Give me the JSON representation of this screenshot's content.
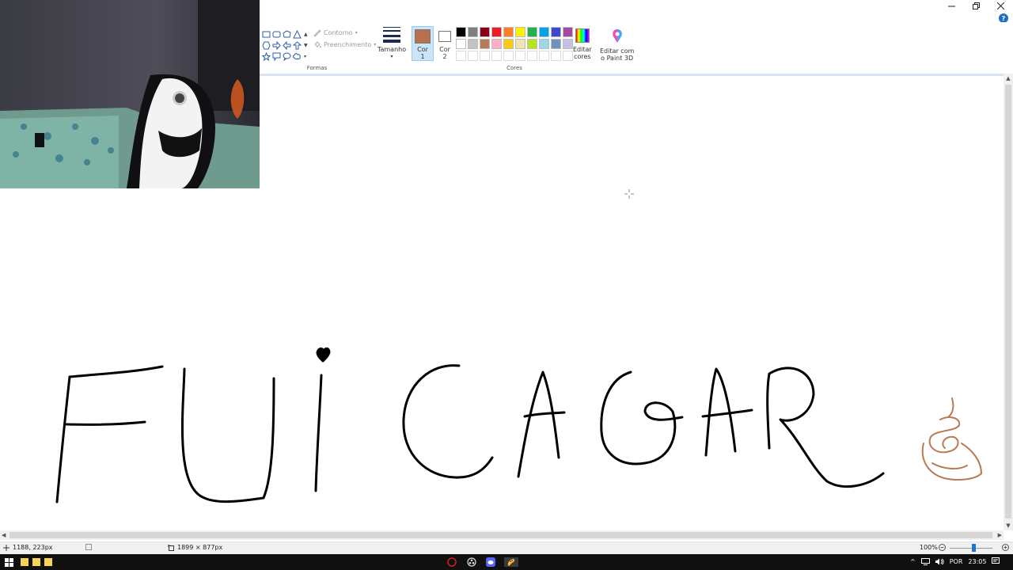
{
  "window": {
    "minimize_icon": "minimize-icon",
    "restore_icon": "restore-icon",
    "close_icon": "close-icon",
    "help_label": "?"
  },
  "ribbon": {
    "groups": {
      "shapes": "Formas",
      "colors": "Cores"
    },
    "outline_label": "Contorno",
    "fill_label": "Preenchimento",
    "size_label": "Tamanho",
    "color1_label": "Cor\n1",
    "color1_line1": "Cor",
    "color1_line2": "1",
    "color2_line1": "Cor",
    "color2_line2": "2",
    "color1_value": "#b9704f",
    "color2_value": "#ffffff",
    "edit_colors_line1": "Editar",
    "edit_colors_line2": "cores",
    "paint3d_line1": "Editar com",
    "paint3d_line2": "o Paint 3D",
    "palette_row1": [
      "#000000",
      "#7f7f7f",
      "#880015",
      "#ed1c24",
      "#ff7f27",
      "#fff200",
      "#22b14c",
      "#00a2e8",
      "#3f48cc",
      "#a349a4"
    ],
    "palette_row2": [
      "#ffffff",
      "#c3c3c3",
      "#b97a57",
      "#ffaec9",
      "#ffc90e",
      "#efe4b0",
      "#b5e61d",
      "#99d9ea",
      "#7092be",
      "#c8bfe7"
    ],
    "palette_row3": [
      "#ffffff",
      "#ffffff",
      "#ffffff",
      "#ffffff",
      "#ffffff",
      "#ffffff",
      "#ffffff",
      "#ffffff",
      "#ffffff",
      "#ffffff"
    ]
  },
  "canvas": {
    "stroke_color": "#000000",
    "accent_stroke": "#b97a57"
  },
  "statusbar": {
    "cursor_pos": "1188, 223px",
    "image_size": "1899 × 877px",
    "zoom": "100%"
  },
  "taskbar": {
    "language": "POR",
    "time": "23:05"
  }
}
